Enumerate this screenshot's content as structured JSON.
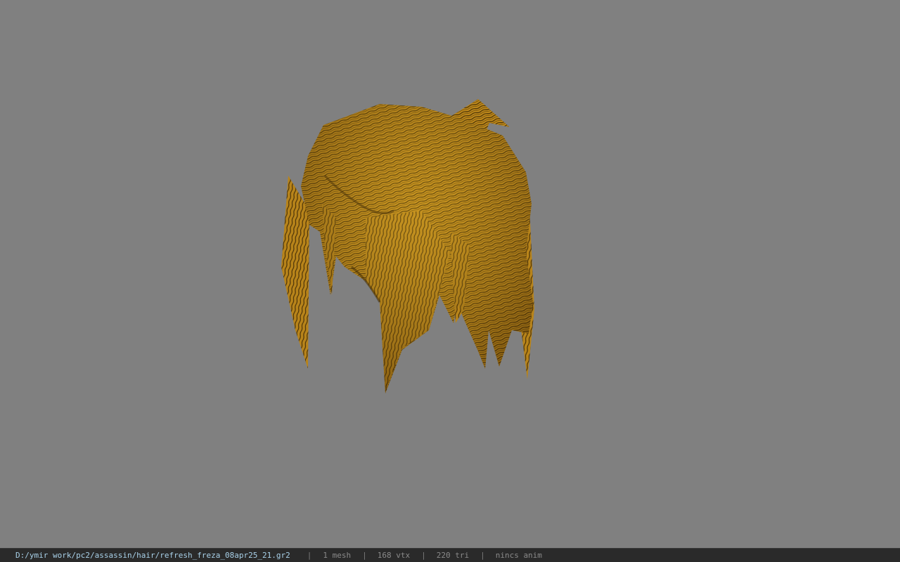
{
  "viewport": {
    "model": "hair-mesh"
  },
  "status": {
    "path": "D:/ymir work/pc2/assassin/hair/refresh_freza_08apr25_21.gr2",
    "separator": "|",
    "mesh": "1 mesh",
    "vertices": "168 vtx",
    "triangles": "220 tri",
    "anim": "nincs anim"
  }
}
